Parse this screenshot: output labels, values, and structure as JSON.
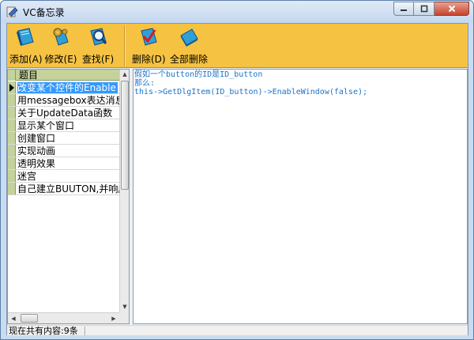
{
  "window": {
    "title": "VC备忘录"
  },
  "toolbar": {
    "add_label": "添加(A)",
    "edit_label": "修改(E)",
    "find_label": "查找(F)",
    "delete_label": "删除(D)",
    "delete_all_label": "全部删除"
  },
  "list": {
    "header": "题目",
    "items": [
      "改变某个控件的Enable",
      "用messagebox表达消息",
      "关于UpdateData函数",
      "显示某个窗口",
      "创建窗口",
      "实现动画",
      "透明效果",
      "迷宫",
      "自己建立BUUTON,并响应函"
    ]
  },
  "editor": {
    "lines": [
      "假如一个button的ID是ID_button",
      "那么:",
      "this->GetDlgItem(ID_button)->EnableWindow(false);"
    ]
  },
  "status": {
    "text": "现在共有内容:9条"
  },
  "colors": {
    "toolbar_bg": "#f5c242",
    "selection": "#3399ff",
    "editor_text": "#1c73c8",
    "list_indicator": "#c4d39b"
  }
}
